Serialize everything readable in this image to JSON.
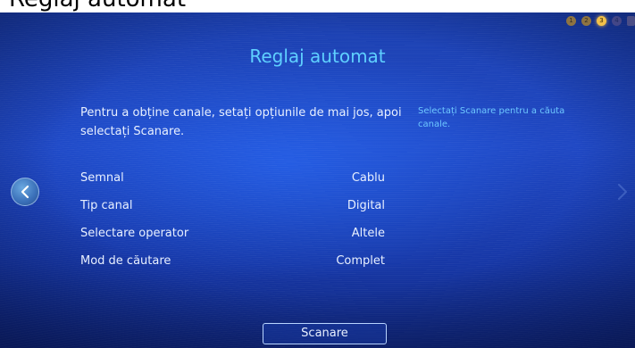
{
  "caption": {
    "text": "Reglaj automat"
  },
  "header": {
    "title": "Reglaj automat",
    "steps": [
      {
        "label": "1",
        "state": "done"
      },
      {
        "label": "2",
        "state": "done"
      },
      {
        "label": "3",
        "state": "active"
      },
      {
        "label": "4",
        "state": "pending"
      }
    ]
  },
  "main": {
    "instruction": "Pentru a obține canale, setați opțiunile de mai jos, apoi selectați Scanare.",
    "help": "Selectați Scanare pentru a căuta canale.",
    "settings": [
      {
        "label": "Semnal",
        "value": "Cablu"
      },
      {
        "label": "Tip canal",
        "value": "Digital"
      },
      {
        "label": "Selectare operator",
        "value": "Altele"
      },
      {
        "label": "Mod de căutare",
        "value": "Complet"
      }
    ]
  },
  "footer": {
    "scan_label": "Scanare"
  },
  "icons": {
    "nav_left": "chevron-left-icon",
    "nav_right": "chevron-right-icon"
  },
  "colors": {
    "title": "#5fd0ff",
    "help_text": "#6ec8ff",
    "background": "#1e47c4",
    "step_active": "#f2c14a"
  }
}
